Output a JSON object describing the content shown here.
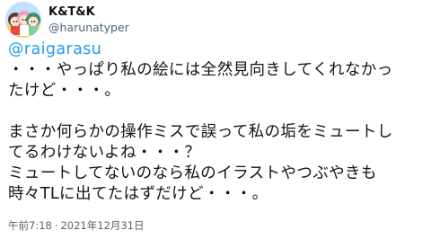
{
  "author": {
    "display_name": "K&T&K",
    "handle": "@harunatyper",
    "avatar_icon": "anime-characters-avatar"
  },
  "tweet": {
    "mention": "@raigarasu",
    "lines": [
      "・・・やっぱり私の絵には全然見向きしてくれなかっ",
      "たけど・・・。",
      "",
      "まさか何らかの操作ミスで誤って私の垢をミュートし",
      "てるわけないよね・・・？",
      "ミュートしてないのなら私のイラストやつぶやきも",
      "時々TLに出てたはずだけど・・・。"
    ],
    "time": "午前7:18",
    "separator": "·",
    "date": "2021年12月31日"
  },
  "colors": {
    "link": "#1d9bf0",
    "text": "#0f1419",
    "muted": "#536471"
  }
}
